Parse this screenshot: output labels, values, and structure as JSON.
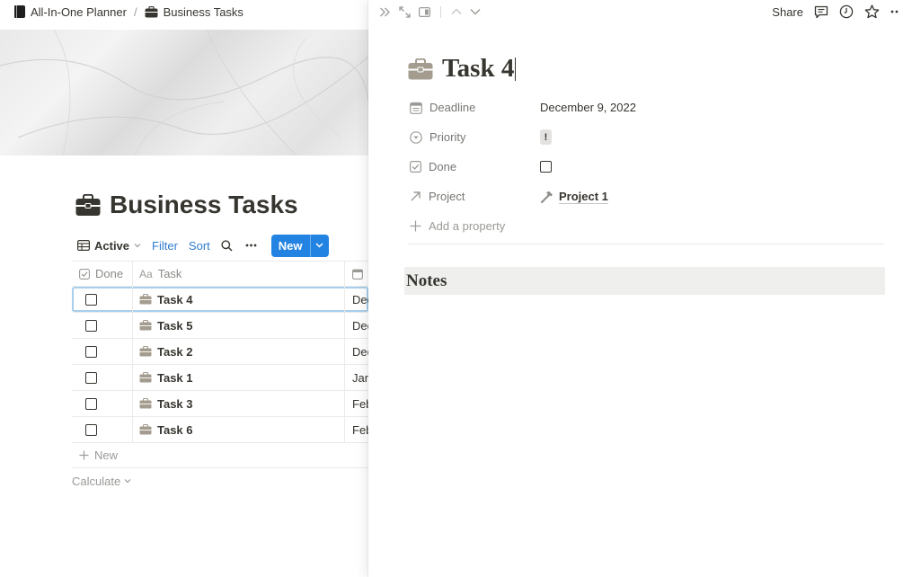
{
  "breadcrumb": {
    "workspace": "All-In-One Planner",
    "separator": "/",
    "page": "Business Tasks"
  },
  "page": {
    "title": "Business Tasks"
  },
  "view": {
    "name": "Active",
    "filter_label": "Filter",
    "sort_label": "Sort",
    "new_label": "New"
  },
  "table": {
    "headers": {
      "done": "Done",
      "task_prefix": "Aa",
      "task": "Task"
    },
    "rows": [
      {
        "task": "Task 4",
        "date": "Dec",
        "done": false
      },
      {
        "task": "Task 5",
        "date": "Dec",
        "done": false
      },
      {
        "task": "Task 2",
        "date": "Dec",
        "done": false
      },
      {
        "task": "Task 1",
        "date": "Jan",
        "done": false
      },
      {
        "task": "Task 3",
        "date": "Feb",
        "done": false
      },
      {
        "task": "Task 6",
        "date": "Feb",
        "done": false
      }
    ],
    "add_new_label": "New",
    "calculate_label": "Calculate"
  },
  "panel": {
    "share_label": "Share",
    "title": "Task 4",
    "properties": {
      "deadline": {
        "label": "Deadline",
        "value": "December 9, 2022"
      },
      "priority": {
        "label": "Priority",
        "value": "!"
      },
      "done": {
        "label": "Done",
        "checked": false
      },
      "project": {
        "label": "Project",
        "value": "Project 1"
      }
    },
    "add_property_label": "Add a property",
    "notes_heading": "Notes"
  },
  "colors": {
    "accent": "#2383e2",
    "link": "#2e7cd1",
    "briefcase": "#a39c8f",
    "text": "#37352f"
  }
}
